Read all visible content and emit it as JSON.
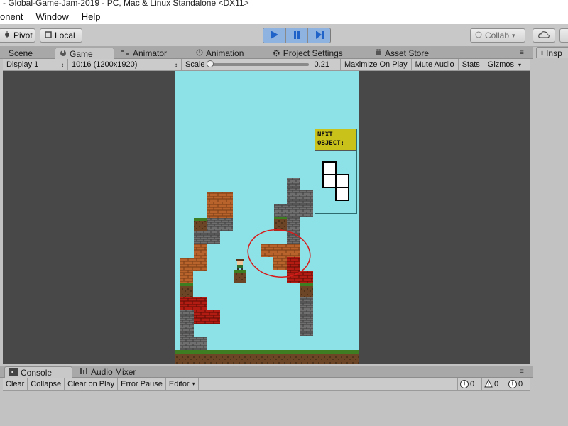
{
  "window": {
    "title": "- Global-Game-Jam-2019 - PC, Mac & Linux Standalone <DX11>"
  },
  "menu": {
    "items": [
      "onent",
      "Window",
      "Help"
    ]
  },
  "toolbar": {
    "pivot_label": "Pivot",
    "local_label": "Local",
    "collab_label": "Collab"
  },
  "tabs": {
    "scene": "Scene",
    "game": "Game",
    "animator": "Animator",
    "animation": "Animation",
    "project_settings": "Project Settings",
    "asset_store": "Asset Store",
    "inspector": "Insp"
  },
  "gamebar": {
    "display": "Display 1",
    "resolution": "10:16 (1200x1920)",
    "scale_label": "Scale",
    "scale_value": "0.21",
    "maximize": "Maximize On Play",
    "mute": "Mute Audio",
    "stats": "Stats",
    "gizmos": "Gizmos"
  },
  "game": {
    "next_object_line1": "NEXT",
    "next_object_line2": "OBJECT:"
  },
  "bottom_tabs": {
    "console": "Console",
    "audio_mixer": "Audio Mixer"
  },
  "console": {
    "clear": "Clear",
    "collapse": "Collapse",
    "clear_on_play": "Clear on Play",
    "error_pause": "Error Pause",
    "editor": "Editor",
    "info_count": "0",
    "warning_count": "0",
    "error_count": "0"
  },
  "colors": {
    "sky": "#8ce2e6",
    "brick_orange": "#b8622c",
    "brick_red": "#b21c12",
    "stone": "#6f6f6f",
    "grass": "#3f7d22",
    "play_active": "#8fb3e0",
    "next_header": "#c9c21a"
  }
}
